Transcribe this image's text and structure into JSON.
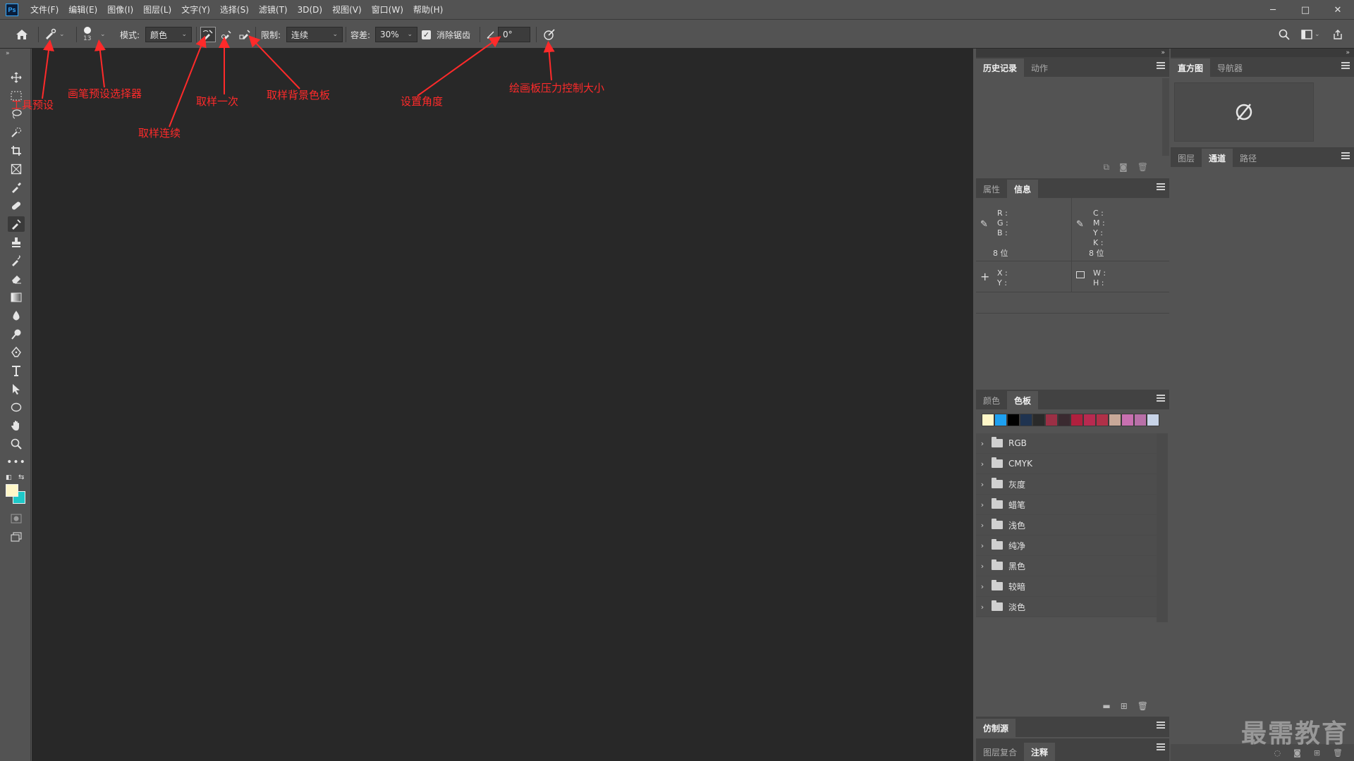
{
  "app": {
    "logo": "Ps"
  },
  "menu": [
    "文件(F)",
    "编辑(E)",
    "图像(I)",
    "图层(L)",
    "文字(Y)",
    "选择(S)",
    "滤镜(T)",
    "3D(D)",
    "视图(V)",
    "窗口(W)",
    "帮助(H)"
  ],
  "window_controls": {
    "minimize": "─",
    "maximize": "□",
    "close": "✕"
  },
  "options": {
    "brush_size": "13",
    "mode_label": "模式:",
    "mode_value": "颜色",
    "limit_label": "限制:",
    "limit_value": "连续",
    "tolerance_label": "容差:",
    "tolerance_value": "30%",
    "antialias_label": "消除锯齿",
    "antialias_checked": true,
    "angle_value": "0°"
  },
  "annotations": {
    "tool_preset": "工具预设",
    "brush_preset": "画笔预设选择器",
    "sample_continuous": "取样连续",
    "sample_once": "取样一次",
    "sample_bg_swatch": "取样背景色板",
    "set_angle": "设置角度",
    "tablet_pressure": "绘画板压力控制大小"
  },
  "panels": {
    "history": {
      "tabs": [
        "历史记录",
        "动作"
      ]
    },
    "info": {
      "tabs": [
        "属性",
        "信息"
      ],
      "rgb_labels": [
        "R :",
        "G :",
        "B :"
      ],
      "cmyk_labels": [
        "C :",
        "M :",
        "Y :",
        "K :"
      ],
      "bits_left": "8 位",
      "bits_right": "8 位",
      "xy_labels": [
        "X :",
        "Y :"
      ],
      "wh_labels": [
        "W :",
        "H :"
      ]
    },
    "swatches": {
      "tabs": [
        "颜色",
        "色板"
      ],
      "colors": [
        "#fff7c8",
        "#1ea0f0",
        "#000000",
        "#1f3350",
        "#2a2a2a",
        "#9b2f45",
        "#3a2a30",
        "#b0203e",
        "#b82a50",
        "#b03048",
        "#c8a898",
        "#c870b0",
        "#b870a8",
        "#c8d4e8"
      ],
      "folders": [
        "RGB",
        "CMYK",
        "灰度",
        "蜡笔",
        "浅色",
        "纯净",
        "黑色",
        "较暗",
        "淡色"
      ]
    },
    "clone_source": {
      "tabs": [
        "仿制源"
      ]
    },
    "layer_comps": {
      "tabs": [
        "图层复合",
        "注释"
      ]
    },
    "histogram": {
      "tabs": [
        "直方图",
        "导航器"
      ]
    },
    "layers": {
      "tabs": [
        "图层",
        "通道",
        "路径"
      ]
    }
  },
  "watermark": "最需教育",
  "colors": {
    "accent_annotation": "#ff2a2a",
    "foreground": "#fff7c8",
    "background": "#1ec8c8"
  }
}
